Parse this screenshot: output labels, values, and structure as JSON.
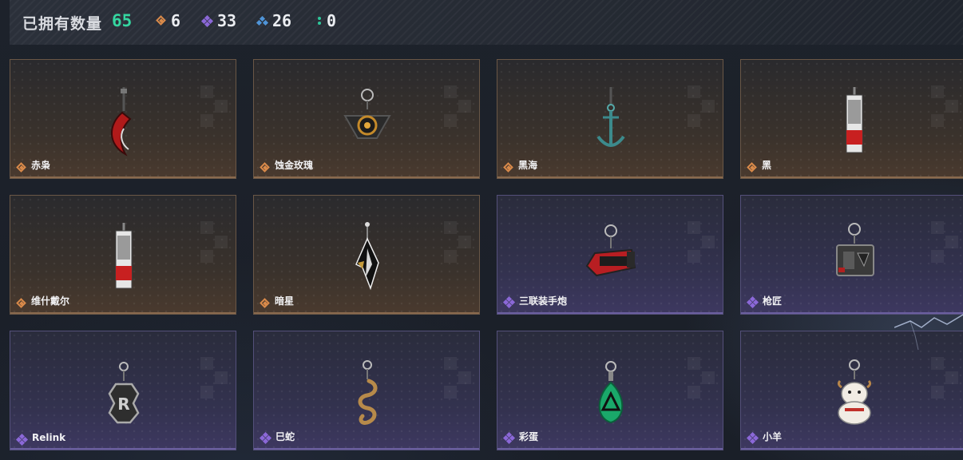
{
  "header": {
    "title": "已拥有数量",
    "total": "65",
    "stats": [
      {
        "icon": "orange-diamond-icon",
        "value": "6",
        "color": "#d98a4a"
      },
      {
        "icon": "purple-cluster-icon",
        "value": "33",
        "color": "#8b68d8"
      },
      {
        "icon": "blue-cluster-icon",
        "value": "26",
        "color": "#4f94d8"
      },
      {
        "icon": "green-dots-icon",
        "value": "0",
        "color": "#2ec79a"
      }
    ]
  },
  "items": [
    {
      "name": "赤枭",
      "rarity": "orange",
      "icon": "red-claw-charm-icon"
    },
    {
      "name": "蚀金玫瑰",
      "rarity": "orange",
      "icon": "gold-rose-charm-icon"
    },
    {
      "name": "黑海",
      "rarity": "orange",
      "icon": "anchor-charm-icon"
    },
    {
      "name": "黑",
      "rarity": "orange",
      "icon": "red-tag-charm-icon"
    },
    {
      "name": "维什戴尔",
      "rarity": "orange",
      "icon": "red-tag-charm-icon"
    },
    {
      "name": "暗星",
      "rarity": "orange",
      "icon": "dark-star-charm-icon"
    },
    {
      "name": "三联装手炮",
      "rarity": "purple",
      "icon": "hand-cannon-charm-icon"
    },
    {
      "name": "枪匠",
      "rarity": "purple",
      "icon": "gunsmith-box-charm-icon"
    },
    {
      "name": "Relink",
      "rarity": "purple",
      "icon": "relink-emblem-charm-icon"
    },
    {
      "name": "巳蛇",
      "rarity": "purple",
      "icon": "snake-charm-icon"
    },
    {
      "name": "彩蛋",
      "rarity": "purple",
      "icon": "green-egg-charm-icon"
    },
    {
      "name": "小羊",
      "rarity": "purple",
      "icon": "lamb-charm-icon"
    }
  ],
  "colors": {
    "accent_green": "#35d6a0",
    "orange": "#d98a4a",
    "purple": "#8b68d8",
    "blue": "#4f94d8"
  }
}
